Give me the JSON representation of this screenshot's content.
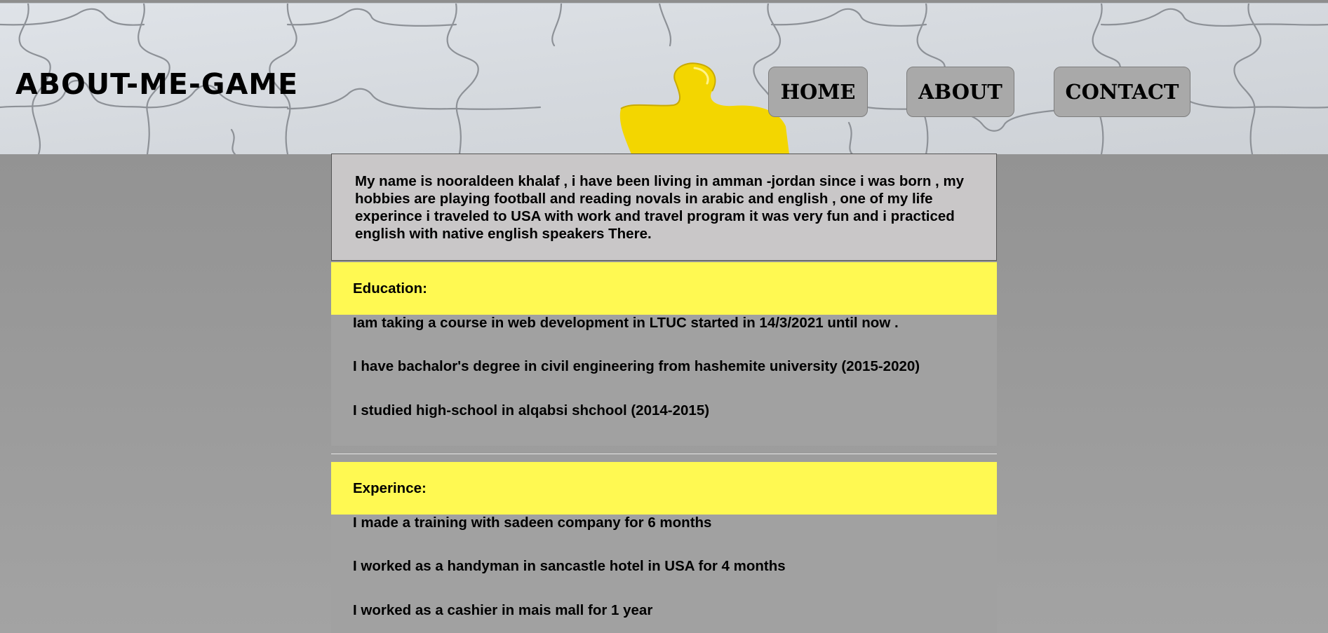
{
  "header": {
    "site_title": "ABOUT-ME-GAME",
    "background_image": "puzzle-pieces-with-yellow-piece",
    "nav": [
      {
        "label": "HOME"
      },
      {
        "label": "ABOUT"
      },
      {
        "label": "CONTACT"
      }
    ]
  },
  "intro": {
    "text": "My name is nooraldeen khalaf , i have been living in amman -jordan since i was born , my hobbies are playing football and reading novals in arabic and english , one of my life experince i traveled to USA with work and travel program it was very fun and i practiced english with native english speakers There."
  },
  "education": {
    "heading": "Education:",
    "items": [
      "Iam taking a course in web development in LTUC started in 14/3/2021 until now .",
      "I have bachalor's degree in civil engineering from hashemite university (2015-2020)",
      "I studied high-school in alqabsi shchool (2014-2015)"
    ]
  },
  "experience": {
    "heading": "Experince:",
    "items": [
      "I made a training with sadeen company for 6 months",
      "I worked as a handyman in sancastle hotel in USA for 4 months",
      "I worked as a cashier in mais mall for 1 year"
    ]
  },
  "colors": {
    "section_bar": "#fff952",
    "intro_box": "#c9c7c8",
    "page_background": "#999999",
    "nav_button": "#a9a9a9",
    "puzzle_accent": "#f3d600"
  }
}
